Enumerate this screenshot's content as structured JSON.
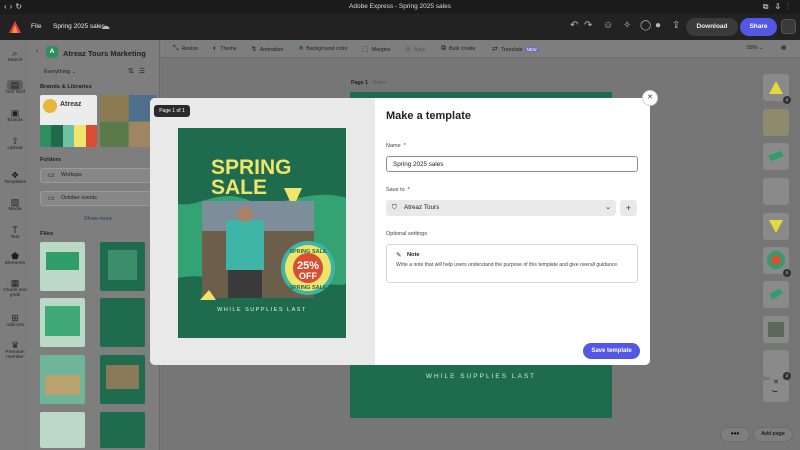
{
  "window": {
    "title": "Adobe Express - Spring 2025 sales"
  },
  "header": {
    "file_menu": "File",
    "doc_title": "Spring 2025 sales",
    "download": "Download",
    "share": "Share"
  },
  "rail": {
    "items": [
      "Search",
      "Your stuff",
      "Brands",
      "Upload",
      "Templates",
      "Media",
      "Text",
      "Elements",
      "Charts and grids",
      "Add-ons",
      "Premium member"
    ]
  },
  "panel": {
    "workspace_initial": "A",
    "workspace_name": "Atreaz Tours Marketing",
    "filter": "Everything",
    "brands_heading": "Brands & Libraries",
    "folders_heading": "Folders",
    "folders": [
      "Workups",
      "October events"
    ],
    "show_more": "Show more",
    "files_heading": "Files"
  },
  "toolbar": {
    "items": [
      "Resize",
      "Theme",
      "Animation",
      "Background color",
      "Margins",
      "Align",
      "Bulk create",
      "Translate"
    ],
    "new_badge": "NEW",
    "zoom": "58%"
  },
  "canvas": {
    "page_label": "Page 1",
    "page_name": "Sales",
    "footer_text": "WHILE SUPPLIES LAST"
  },
  "right_strip": {
    "badges": [
      "2",
      "2",
      "2"
    ]
  },
  "bottom": {
    "dots": "•••",
    "add_page": "Add page"
  },
  "modal": {
    "page_badge": "Page 1 of 1",
    "title": "Make a template",
    "name_label": "Name",
    "required_mark": "*",
    "name_value": "Spring 2025 sales",
    "save_to_label": "Save to",
    "save_to_value": "Atreaz Tours",
    "optional_label": "Optional settings",
    "note_title": "Note",
    "note_desc": "Write a note that will help users understand the purpose of this template and give overall guidance.",
    "save_button": "Save template"
  },
  "preview": {
    "headline1": "SPRING",
    "headline2": "SALE",
    "badge_top": "SPRING SALE",
    "badge_percent": "25%",
    "badge_off": "OFF",
    "badge_bottom": "SPRING SALE",
    "footer": "WHILE SUPPLIES LAST"
  },
  "colors": {
    "accent": "#5258e4",
    "green": "#2f9e6b",
    "yellow": "#f1e46a",
    "dark_green": "#1f6b4e"
  }
}
